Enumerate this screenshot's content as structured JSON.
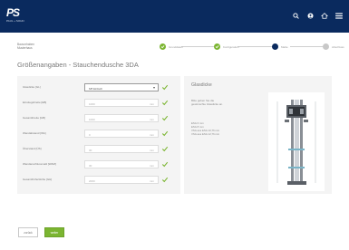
{
  "brand": {
    "name": "PS",
    "tagline": "PAUL + SOHN"
  },
  "breadcrumb": {
    "lines": [
      "Bauvorhaben",
      "Musterhaus"
    ]
  },
  "steps": [
    {
      "label": "Grunddaten",
      "state": "done"
    },
    {
      "label": "Konfiguration",
      "state": "done"
    },
    {
      "label": "Maße",
      "state": "active"
    },
    {
      "label": "Abschluss",
      "state": "pending"
    }
  ],
  "page_title": "Größenangaben - Stauchendusche 3DA",
  "form": {
    "rows": [
      {
        "label": "Glasdicke [GL]",
        "value": "6/8 Einfach",
        "unit": "",
        "type": "select"
      },
      {
        "label": "Einstiegsbreite [EB]",
        "value": "1000",
        "unit": "mm",
        "type": "input"
      },
      {
        "label": "Gesamtbreite [GB]",
        "value": "1000",
        "unit": "mm",
        "type": "input"
      },
      {
        "label": "Wandabstand [WA]",
        "value": "0",
        "unit": "mm",
        "type": "input"
      },
      {
        "label": "Überstand [ÜS]",
        "value": "30",
        "unit": "mm",
        "type": "input"
      },
      {
        "label": "Wandanschlussmaß [WAM]",
        "value": "30",
        "unit": "mm",
        "type": "input"
      },
      {
        "label": "Gesamthöhe/Höhe [GH]",
        "value": "2000",
        "unit": "mm",
        "type": "input"
      }
    ]
  },
  "info": {
    "title": "Glasdicke",
    "description": "Bitte geben Sie die gewünschte Glasdicke an.",
    "options": [
      "ESG 6 mm",
      "ESG 8 mm",
      "VSG aus ESG 10,76 mm",
      "VSG aus ESG 12,76 mm"
    ]
  },
  "buttons": {
    "back": "zurück",
    "next": "weiter"
  },
  "colors": {
    "header": "#0a2a5e",
    "accent": "#7bb531",
    "panel": "#f4f4f4"
  }
}
